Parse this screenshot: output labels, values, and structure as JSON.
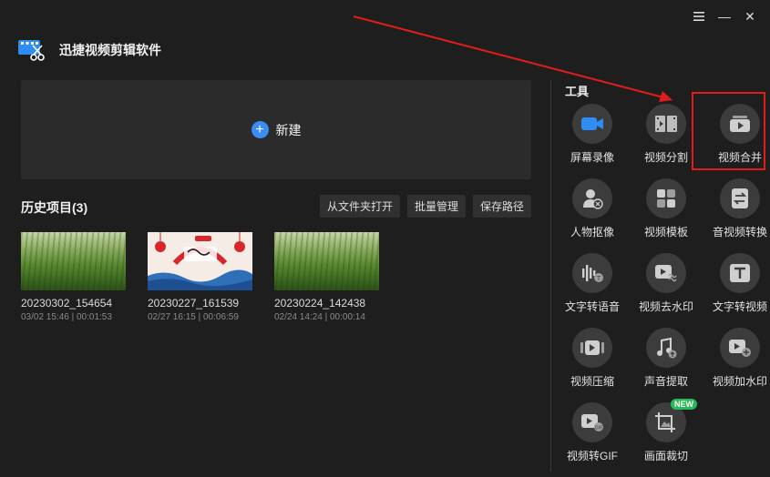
{
  "window": {
    "minimize": "—",
    "close": "✕"
  },
  "app": {
    "title": "迅捷视频剪辑软件"
  },
  "new_project": {
    "label": "新建"
  },
  "history": {
    "title": "历史项目(3)",
    "actions": [
      "从文件夹打开",
      "批量管理",
      "保存路径"
    ],
    "projects": [
      {
        "name": "20230302_154654",
        "meta": "03/02 15:46 | 00:01:53",
        "thumb": "grass"
      },
      {
        "name": "20230227_161539",
        "meta": "02/27 16:15 | 00:06:59",
        "thumb": "festive"
      },
      {
        "name": "20230224_142438",
        "meta": "02/24 14:24 | 00:00:14",
        "thumb": "grass"
      }
    ]
  },
  "tools": {
    "title": "工具",
    "new_badge": "NEW",
    "items": [
      {
        "label": "屏幕录像",
        "icon": "camera-icon"
      },
      {
        "label": "视频分割",
        "icon": "film-split-icon"
      },
      {
        "label": "视频合并",
        "icon": "video-merge-icon"
      },
      {
        "label": "人物抠像",
        "icon": "person-cutout-icon"
      },
      {
        "label": "视频模板",
        "icon": "template-icon"
      },
      {
        "label": "音视频转换",
        "icon": "convert-icon"
      },
      {
        "label": "文字转语音",
        "icon": "text-to-speech-icon"
      },
      {
        "label": "视频去水印",
        "icon": "remove-watermark-icon"
      },
      {
        "label": "文字转视频",
        "icon": "text-to-video-icon"
      },
      {
        "label": "视频压缩",
        "icon": "compress-icon"
      },
      {
        "label": "声音提取",
        "icon": "audio-extract-icon"
      },
      {
        "label": "视频加水印",
        "icon": "add-watermark-icon"
      },
      {
        "label": "视频转GIF",
        "icon": "gif-icon"
      },
      {
        "label": "画面裁切",
        "icon": "crop-icon"
      }
    ]
  },
  "colors": {
    "accent": "#3b8cf5",
    "highlight": "#e01c1c",
    "badge": "#29b85a"
  }
}
